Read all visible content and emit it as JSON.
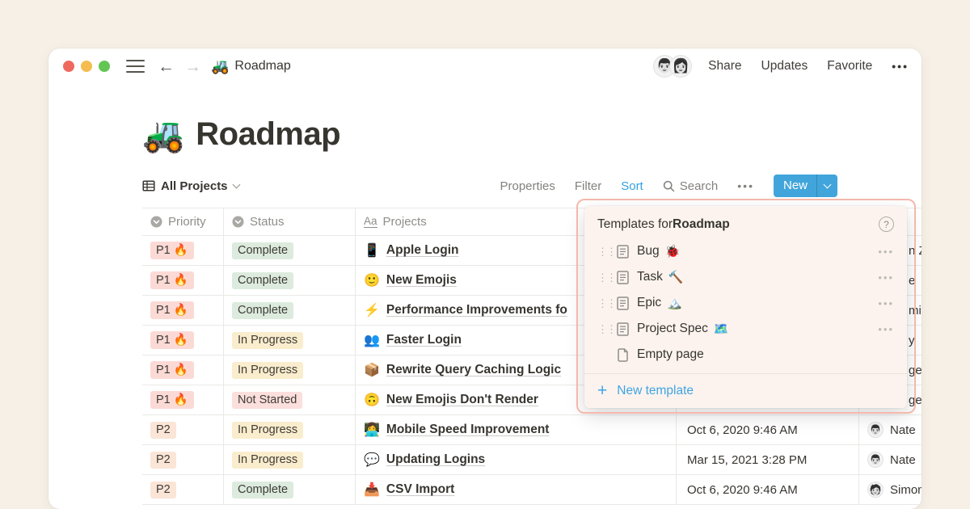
{
  "colors": {
    "canvas_background": "#F6F0E7",
    "accent_blue": "#41A5DB",
    "link_blue": "#3FA4E2",
    "highlight_border": "#F4B8AB",
    "popup_background": "#FCF3EF",
    "tag_red": "#FBDAD6",
    "tag_peach": "#FAE5D7",
    "tag_green": "#DCEBDD",
    "tag_yellow": "#FAEDCD",
    "tag_light_red": "#FBDFDC",
    "table_border": "#E9E9E7"
  },
  "icons": {
    "back": "←",
    "forward": "→",
    "more_h": "•••",
    "drag_handle": "⋮⋮",
    "plus": "+",
    "help": "?",
    "text_property": "Aa"
  },
  "topbar": {
    "doc_emoji": "🚜",
    "doc_title": "Roadmap",
    "avatars": [
      "👨🏻",
      "👩🏻"
    ],
    "actions": {
      "share": "Share",
      "updates": "Updates",
      "favorite": "Favorite"
    }
  },
  "page": {
    "emoji": "🚜",
    "title": "Roadmap"
  },
  "view_bar": {
    "view_label": "All Projects",
    "properties": "Properties",
    "filter": "Filter",
    "sort": "Sort",
    "search": "Search",
    "new_label": "New"
  },
  "table": {
    "headers": {
      "priority": "Priority",
      "status": "Status",
      "projects": "Projects"
    },
    "rows": [
      {
        "priority": "P1 🔥",
        "status": "Complete",
        "project_emoji": "📱",
        "project": "Apple Login"
      },
      {
        "priority": "P1 🔥",
        "status": "Complete",
        "project_emoji": "🙂",
        "project": "New Emojis"
      },
      {
        "priority": "P1 🔥",
        "status": "Complete",
        "project_emoji": "⚡",
        "project": "Performance Improvements fo"
      },
      {
        "priority": "P1 🔥",
        "status": "In Progress",
        "project_emoji": "👥",
        "project": "Faster Login"
      },
      {
        "priority": "P1 🔥",
        "status": "In Progress",
        "project_emoji": "📦",
        "project": "Rewrite Query Caching Logic"
      },
      {
        "priority": "P1 🔥",
        "status": "Not Started",
        "project_emoji": "🙃",
        "project": "New Emojis Don't Render"
      },
      {
        "priority": "P2",
        "status": "In Progress",
        "project_emoji": "👩‍💻",
        "project": "Mobile Speed Improvement",
        "date": "Oct 6, 2020 9:46 AM",
        "person": "Nate",
        "person_avatar": "👨🏻"
      },
      {
        "priority": "P2",
        "status": "In Progress",
        "project_emoji": "💬",
        "project": "Updating Logins",
        "date": "Mar 15, 2021 3:28 PM",
        "person": "Nate",
        "person_avatar": "👨🏻"
      },
      {
        "priority": "P2",
        "status": "Complete",
        "project_emoji": "📥",
        "project": "CSV Import",
        "date": "Oct 6, 2020 9:46 AM",
        "person": "Simon",
        "person_avatar": "🧑🏻"
      }
    ],
    "edge_fragments": [
      "n Z",
      "e",
      "mi",
      "y",
      "ge",
      "ge"
    ]
  },
  "popup": {
    "title_prefix": "Templates for ",
    "title_bold": "Roadmap",
    "items": [
      {
        "label": "Bug",
        "emoji": "🐞"
      },
      {
        "label": "Task",
        "emoji": "🔨"
      },
      {
        "label": "Epic",
        "emoji": "🏔️"
      },
      {
        "label": "Project Spec",
        "emoji": "🗺️"
      }
    ],
    "empty_page": "Empty page",
    "new_template": "New template"
  }
}
